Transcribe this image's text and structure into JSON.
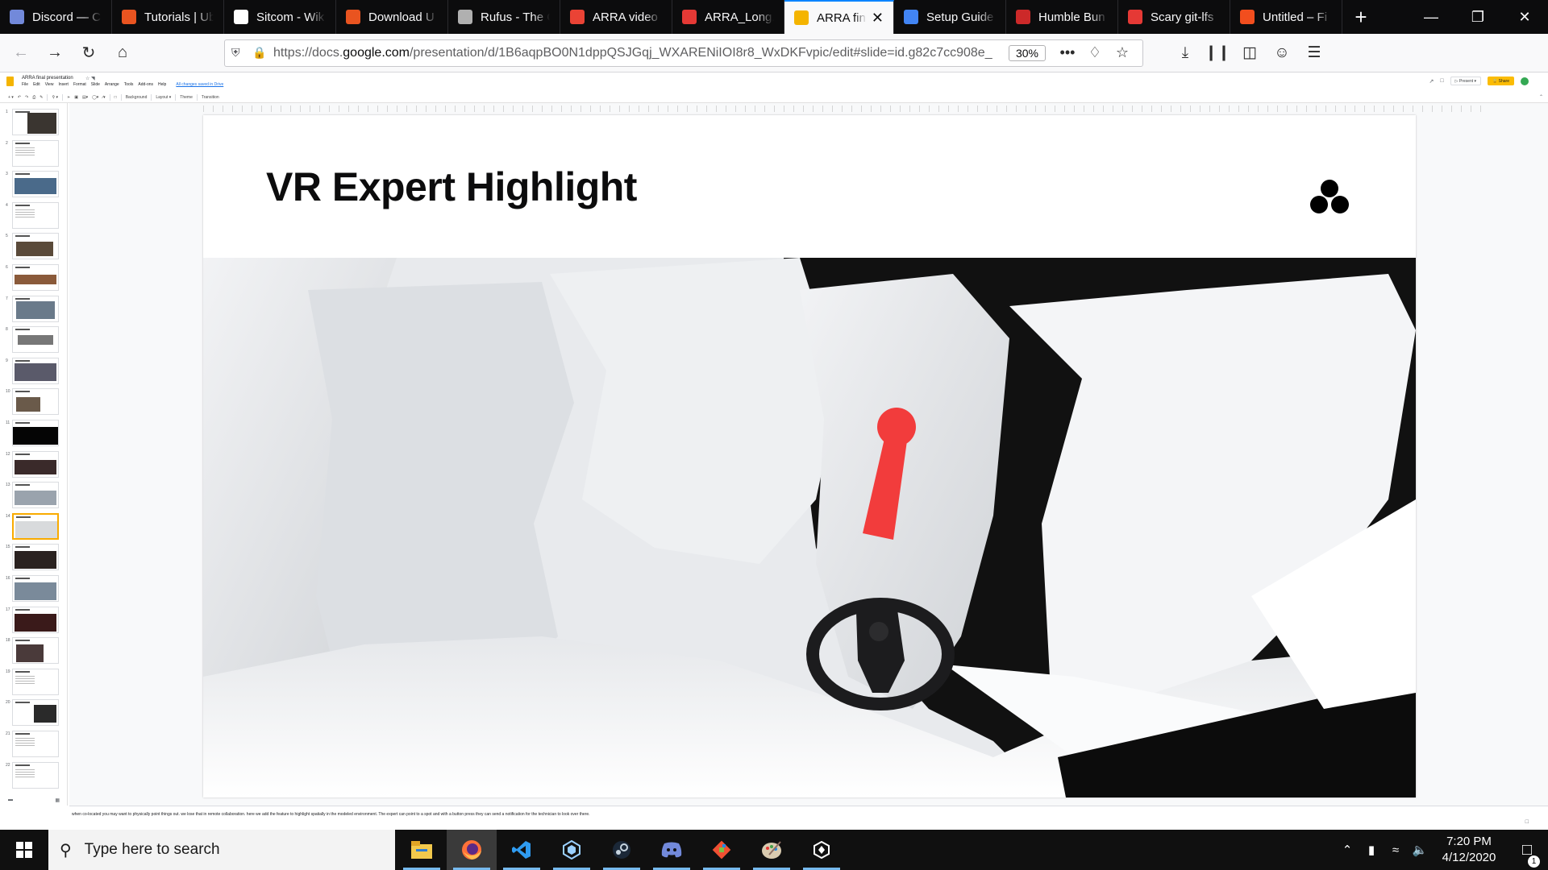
{
  "browser": {
    "tabs": [
      {
        "label": "Discord — C",
        "icon": "discord-icon",
        "color": "#7289da"
      },
      {
        "label": "Tutorials | Ub",
        "icon": "ubuntu-icon",
        "color": "#e95420"
      },
      {
        "label": "Sitcom - Wik",
        "icon": "wikipedia-icon",
        "color": "#ffffff"
      },
      {
        "label": "Download U",
        "icon": "ubuntu-icon",
        "color": "#e95420"
      },
      {
        "label": "Rufus - The C",
        "icon": "rufus-icon",
        "color": "#b0b0b0"
      },
      {
        "label": "ARRA video",
        "icon": "gmail-icon",
        "color": "#ea4335"
      },
      {
        "label": "ARRA_Long.r",
        "icon": "clapper-icon",
        "color": "#e53935"
      },
      {
        "label": "ARRA fin",
        "icon": "slides-icon",
        "color": "#f4b400",
        "active": true
      },
      {
        "label": "Setup Guide",
        "icon": "docs-icon",
        "color": "#4285f4"
      },
      {
        "label": "Humble Bun",
        "icon": "humble-icon",
        "color": "#cc2929"
      },
      {
        "label": "Scary git-lfs",
        "icon": "pdf-icon",
        "color": "#e53935"
      },
      {
        "label": "Untitled – Fi",
        "icon": "figma-icon",
        "color": "#f24e1e"
      }
    ],
    "url_prefix": "https://docs.",
    "url_domain": "google.com",
    "url_rest": "/presentation/d/1B6aqpBO0N1dppQSJGqj_WXARENiIOI8r8_WxDKFvpic/edit#slide=id.g82c7cc908e_",
    "zoom": "30%"
  },
  "slides_app": {
    "doc_title": "ARRA final presentation",
    "menu": [
      "File",
      "Edit",
      "View",
      "Insert",
      "Format",
      "Slide",
      "Arrange",
      "Tools",
      "Add-ons",
      "Help"
    ],
    "saved_status": "All changes saved in Drive",
    "toolbar": {
      "background": "Background",
      "layout": "Layout",
      "theme": "Theme",
      "transition": "Transition"
    },
    "present_label": "Present",
    "share_label": "Share",
    "slide_count": 22,
    "selected_slide": 14,
    "speaker_notes": "when co-located you may want to physically point things out. we lose that in remote collaboration. here we add the feature to highlight spatially in the modeled environment. The expert can point to a spot and with a button press they can send a notification for the technician to look over there."
  },
  "slide": {
    "title": "VR Expert Highlight",
    "colors": {
      "marker": "#f23c3c",
      "controller": "#1c1c1e"
    }
  },
  "taskbar": {
    "search_placeholder": "Type here to search",
    "apps": [
      "file-explorer-icon",
      "firefox-icon",
      "vscode-icon",
      "unity-hub-icon",
      "steam-icon",
      "discord-icon",
      "git-icon",
      "paint-icon",
      "unity-icon"
    ],
    "time": "7:20 PM",
    "date": "4/12/2020",
    "notification_count": "1"
  }
}
